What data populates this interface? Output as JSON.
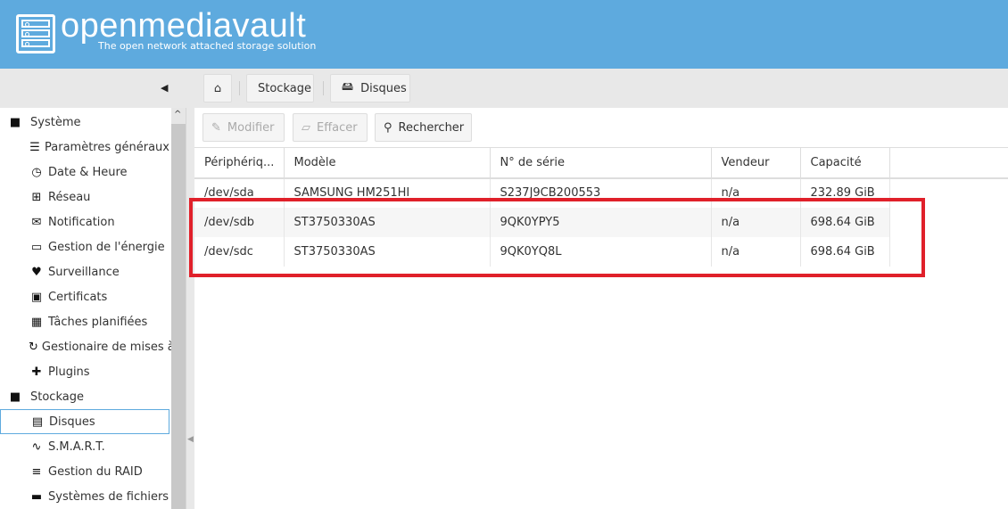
{
  "header": {
    "brand": "openmediavault",
    "tagline": "The open network attached storage solution"
  },
  "breadcrumb": [
    {
      "label": "Stockage"
    },
    {
      "label": "Disques"
    }
  ],
  "sidebar": {
    "items": [
      {
        "label": "Système",
        "icon": "minus-square-icon",
        "type": "group"
      },
      {
        "label": "Paramètres généraux",
        "icon": "sliders-icon"
      },
      {
        "label": "Date & Heure",
        "icon": "clock-icon"
      },
      {
        "label": "Réseau",
        "icon": "network-icon"
      },
      {
        "label": "Notification",
        "icon": "envelope-icon"
      },
      {
        "label": "Gestion de l'énergie",
        "icon": "battery-icon"
      },
      {
        "label": "Surveillance",
        "icon": "heartbeat-icon"
      },
      {
        "label": "Certificats",
        "icon": "certificate-icon"
      },
      {
        "label": "Tâches planifiées",
        "icon": "calendar-clock-icon"
      },
      {
        "label": "Gestionaire de mises à jour",
        "icon": "refresh-icon"
      },
      {
        "label": "Plugins",
        "icon": "puzzle-icon"
      },
      {
        "label": "Stockage",
        "icon": "minus-square-icon",
        "type": "group"
      },
      {
        "label": "Disques",
        "icon": "hdd-icon",
        "selected": true
      },
      {
        "label": "S.M.A.R.T.",
        "icon": "pulse-icon"
      },
      {
        "label": "Gestion du RAID",
        "icon": "database-icon"
      },
      {
        "label": "Systèmes de fichiers",
        "icon": "folder-icon"
      }
    ]
  },
  "toolbar": {
    "edit": "Modifier",
    "wipe": "Effacer",
    "search": "Rechercher"
  },
  "table": {
    "columns": [
      "Périphériq...",
      "Modèle",
      "N° de série",
      "Vendeur",
      "Capacité"
    ],
    "rows": [
      [
        "/dev/sda",
        "SAMSUNG HM251HI",
        "S237J9CB200553",
        "n/a",
        "232.89 GiB"
      ],
      [
        "/dev/sdb",
        "ST3750330AS",
        "9QK0YPY5",
        "n/a",
        "698.64 GiB"
      ],
      [
        "/dev/sdc",
        "ST3750330AS",
        "9QK0YQ8L",
        "n/a",
        "698.64 GiB"
      ]
    ]
  },
  "colors": {
    "header": "#5eaade",
    "highlight": "#e0202a"
  }
}
